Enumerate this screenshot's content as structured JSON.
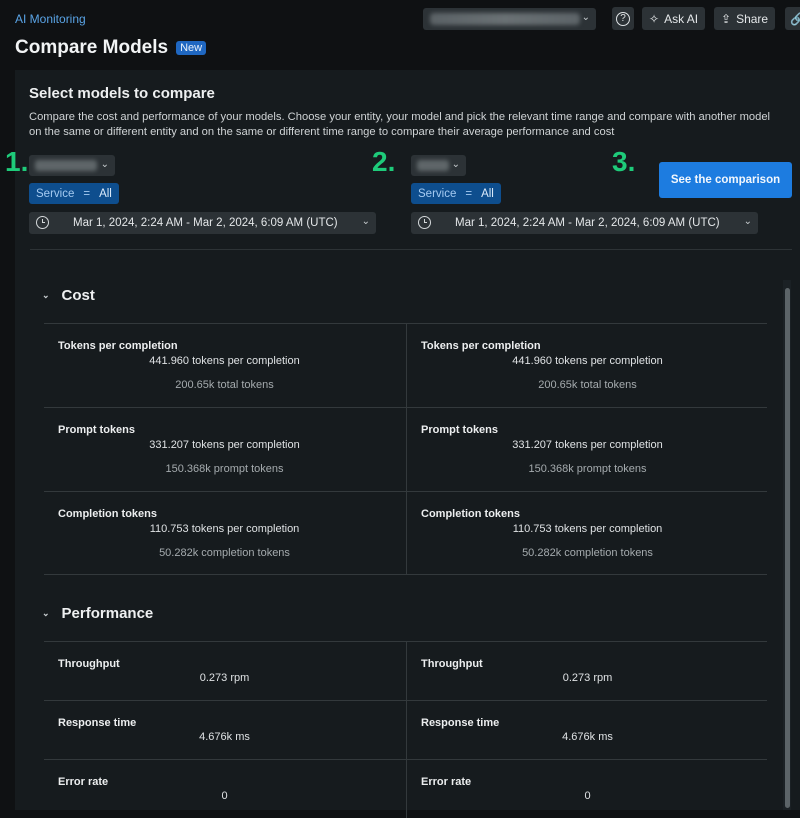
{
  "header": {
    "breadcrumb": "AI Monitoring",
    "title": "Compare Models",
    "badge": "New",
    "account_selector": "(redacted)",
    "help_icon": "question-circle-icon",
    "ask_ai_label": "Ask AI",
    "share_label": "Share",
    "link_icon": "link-icon"
  },
  "selector": {
    "title": "Select models to compare",
    "description": "Compare the cost and performance of your models. Choose your entity, your model and pick the relevant time range and compare with another model on the same or different entity and on the same or different time range to compare their average performance and cost",
    "steps": [
      "1.",
      "2.",
      "3."
    ],
    "models": [
      {
        "model_select": "(redacted)",
        "filter_key": "Service",
        "filter_op": "=",
        "filter_value": "All",
        "time_range": "Mar 1, 2024, 2:24 AM - Mar 2, 2024, 6:09 AM (UTC)"
      },
      {
        "model_select": "(redacted)",
        "filter_key": "Service",
        "filter_op": "=",
        "filter_value": "All",
        "time_range": "Mar 1, 2024, 2:24 AM - Mar 2, 2024, 6:09 AM (UTC)"
      }
    ],
    "compare_button": "See the comparison"
  },
  "sections": {
    "cost": {
      "title": "Cost",
      "rows": [
        {
          "label": "Tokens per completion",
          "left": {
            "value": "441.960 tokens per completion",
            "sub": "200.65k total tokens"
          },
          "right": {
            "value": "441.960 tokens per completion",
            "sub": "200.65k total tokens"
          }
        },
        {
          "label": "Prompt tokens",
          "left": {
            "value": "331.207 tokens per completion",
            "sub": "150.368k prompt tokens"
          },
          "right": {
            "value": "331.207 tokens per completion",
            "sub": "150.368k prompt tokens"
          }
        },
        {
          "label": "Completion tokens",
          "left": {
            "value": "110.753 tokens per completion",
            "sub": "50.282k completion tokens"
          },
          "right": {
            "value": "110.753 tokens per completion",
            "sub": "50.282k completion tokens"
          }
        }
      ]
    },
    "performance": {
      "title": "Performance",
      "rows": [
        {
          "label": "Throughput",
          "left": {
            "value": "0.273 rpm"
          },
          "right": {
            "value": "0.273 rpm"
          }
        },
        {
          "label": "Response time",
          "left": {
            "value": "4.676k ms"
          },
          "right": {
            "value": "4.676k ms"
          }
        },
        {
          "label": "Error rate",
          "left": {
            "value": "0"
          },
          "right": {
            "value": "0"
          }
        }
      ]
    }
  },
  "colors": {
    "accent": "#1d7ce0",
    "step_numbers": "#1ecb7a",
    "filter_chip": "#0e4e8e"
  }
}
